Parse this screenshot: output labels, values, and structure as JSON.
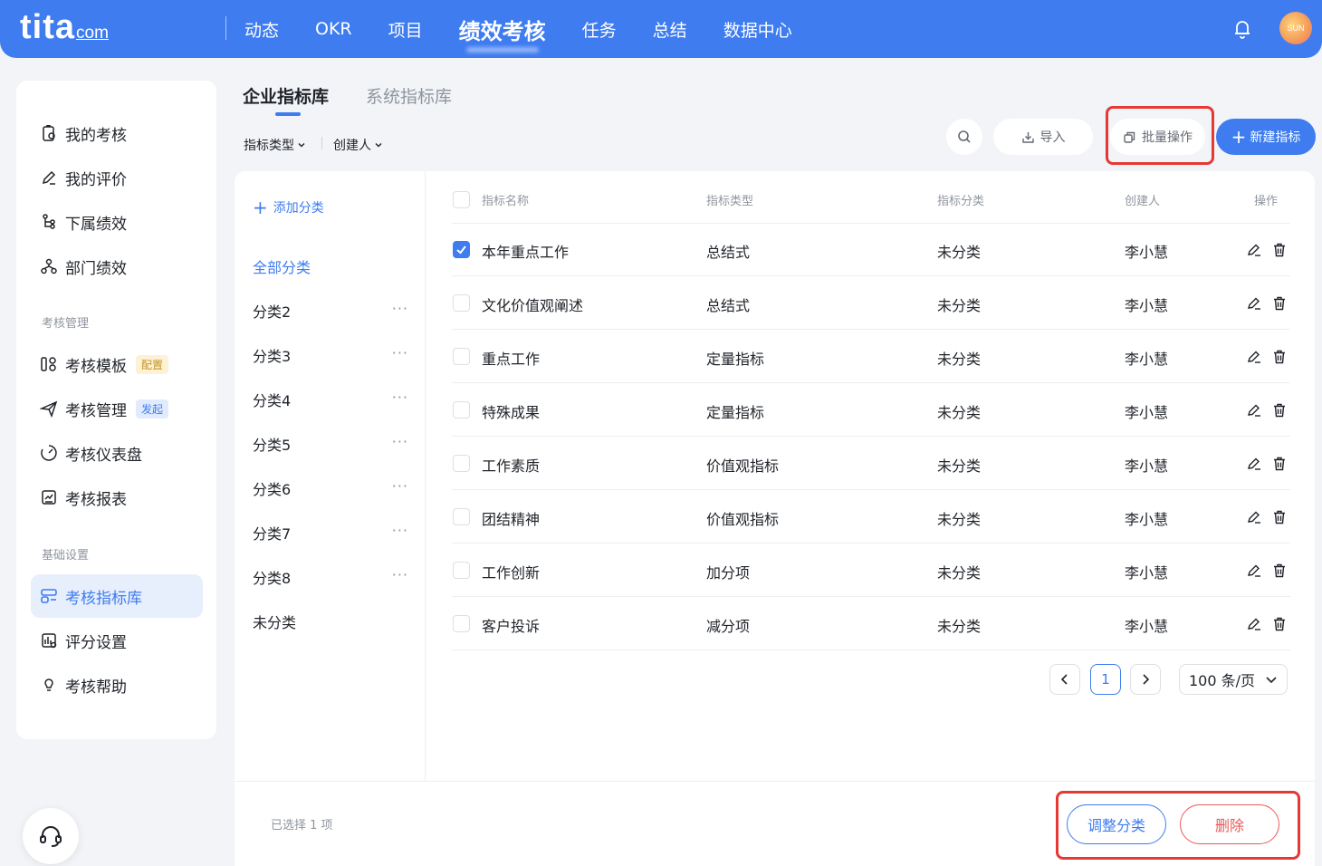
{
  "header": {
    "logo_main": "tita",
    "logo_suffix": "com",
    "nav": [
      "动态",
      "OKR",
      "项目",
      "绩效考核",
      "任务",
      "总结",
      "数据中心"
    ],
    "avatar_text": "SUN"
  },
  "sidebar": {
    "items_top": [
      "我的考核",
      "我的评价",
      "下属绩效",
      "部门绩效"
    ],
    "section_manage": "考核管理",
    "items_manage": [
      "考核模板",
      "考核管理",
      "考核仪表盘",
      "考核报表"
    ],
    "tag_template": "配置",
    "tag_manage": "发起",
    "section_base": "基础设置",
    "items_base": [
      "考核指标库",
      "评分设置",
      "考核帮助"
    ]
  },
  "tabs": [
    "企业指标库",
    "系统指标库"
  ],
  "filters": [
    "指标类型",
    "创建人"
  ],
  "toolbar": {
    "import_label": "导入",
    "batch_label": "批量操作",
    "new_label": "新建指标"
  },
  "categories": {
    "add_label": "添加分类",
    "all_label": "全部分类",
    "items": [
      "分类2",
      "分类3",
      "分类4",
      "分类5",
      "分类6",
      "分类7",
      "分类8"
    ],
    "unclassified": "未分类",
    "more": "···"
  },
  "table": {
    "columns": [
      "指标名称",
      "指标类型",
      "指标分类",
      "创建人",
      "操作"
    ],
    "rows": [
      {
        "name": "本年重点工作",
        "type": "总结式",
        "category": "未分类",
        "creator": "李小慧",
        "checked": true
      },
      {
        "name": "文化价值观阐述",
        "type": "总结式",
        "category": "未分类",
        "creator": "李小慧",
        "checked": false
      },
      {
        "name": "重点工作",
        "type": "定量指标",
        "category": "未分类",
        "creator": "李小慧",
        "checked": false
      },
      {
        "name": "特殊成果",
        "type": "定量指标",
        "category": "未分类",
        "creator": "李小慧",
        "checked": false
      },
      {
        "name": "工作素质",
        "type": "价值观指标",
        "category": "未分类",
        "creator": "李小慧",
        "checked": false
      },
      {
        "name": "团结精神",
        "type": "价值观指标",
        "category": "未分类",
        "creator": "李小慧",
        "checked": false
      },
      {
        "name": "工作创新",
        "type": "加分项",
        "category": "未分类",
        "creator": "李小慧",
        "checked": false
      },
      {
        "name": "客户投诉",
        "type": "减分项",
        "category": "未分类",
        "creator": "李小慧",
        "checked": false
      }
    ]
  },
  "pagination": {
    "current_page": "1",
    "page_size": "100 条/页"
  },
  "footer": {
    "selected_text": "已选择 1 项",
    "adjust_label": "调整分类",
    "delete_label": "删除"
  },
  "colors": {
    "primary": "#3e7cf0",
    "danger": "#e85a5a",
    "highlight": "#e53935"
  }
}
